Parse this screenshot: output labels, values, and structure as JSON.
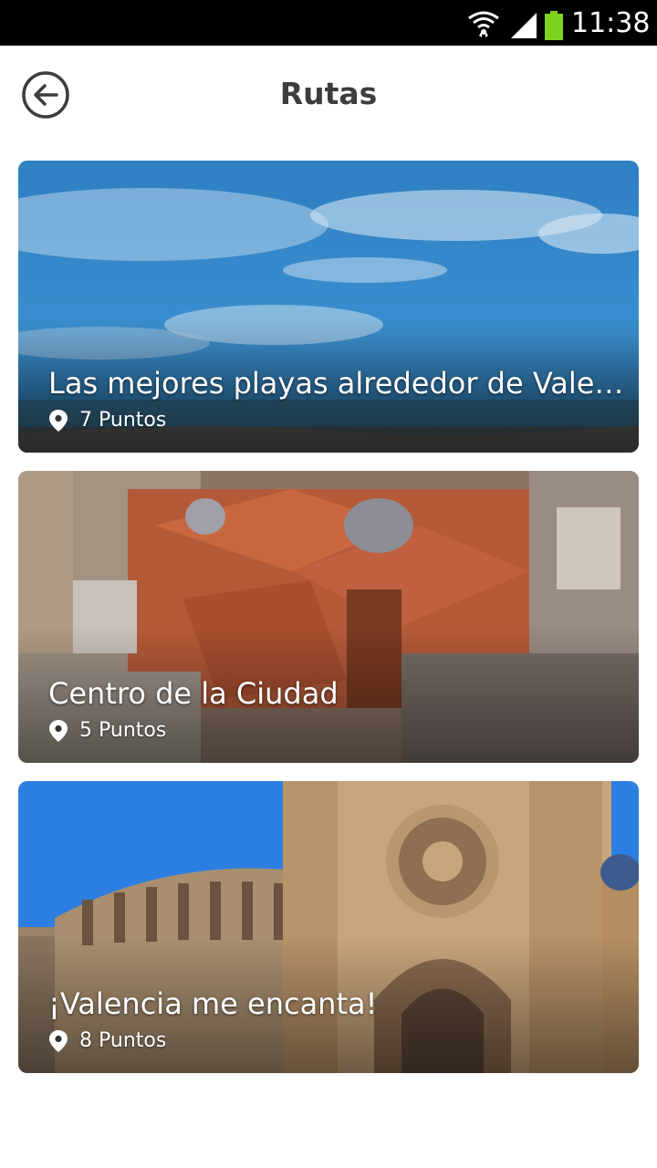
{
  "status_bar": {
    "time": "11:38",
    "icons": [
      "wifi-icon",
      "signal-icon",
      "battery-icon"
    ],
    "battery_color": "#7ED321"
  },
  "header": {
    "title": "Rutas",
    "back_icon": "arrow-left-circle-icon"
  },
  "routes": [
    {
      "title": "Las mejores playas alrededor de Valen...",
      "points": "7 Puntos",
      "pin_icon": "map-pin-icon"
    },
    {
      "title": "Centro de la Ciudad",
      "points": "5 Puntos",
      "pin_icon": "map-pin-icon"
    },
    {
      "title": "¡Valencia me encanta!",
      "points": "8 Puntos",
      "pin_icon": "map-pin-icon"
    }
  ],
  "colors": {
    "title_text": "#3d3d3d",
    "status_bar_bg": "#000000",
    "overlay_text": "#ffffff"
  }
}
